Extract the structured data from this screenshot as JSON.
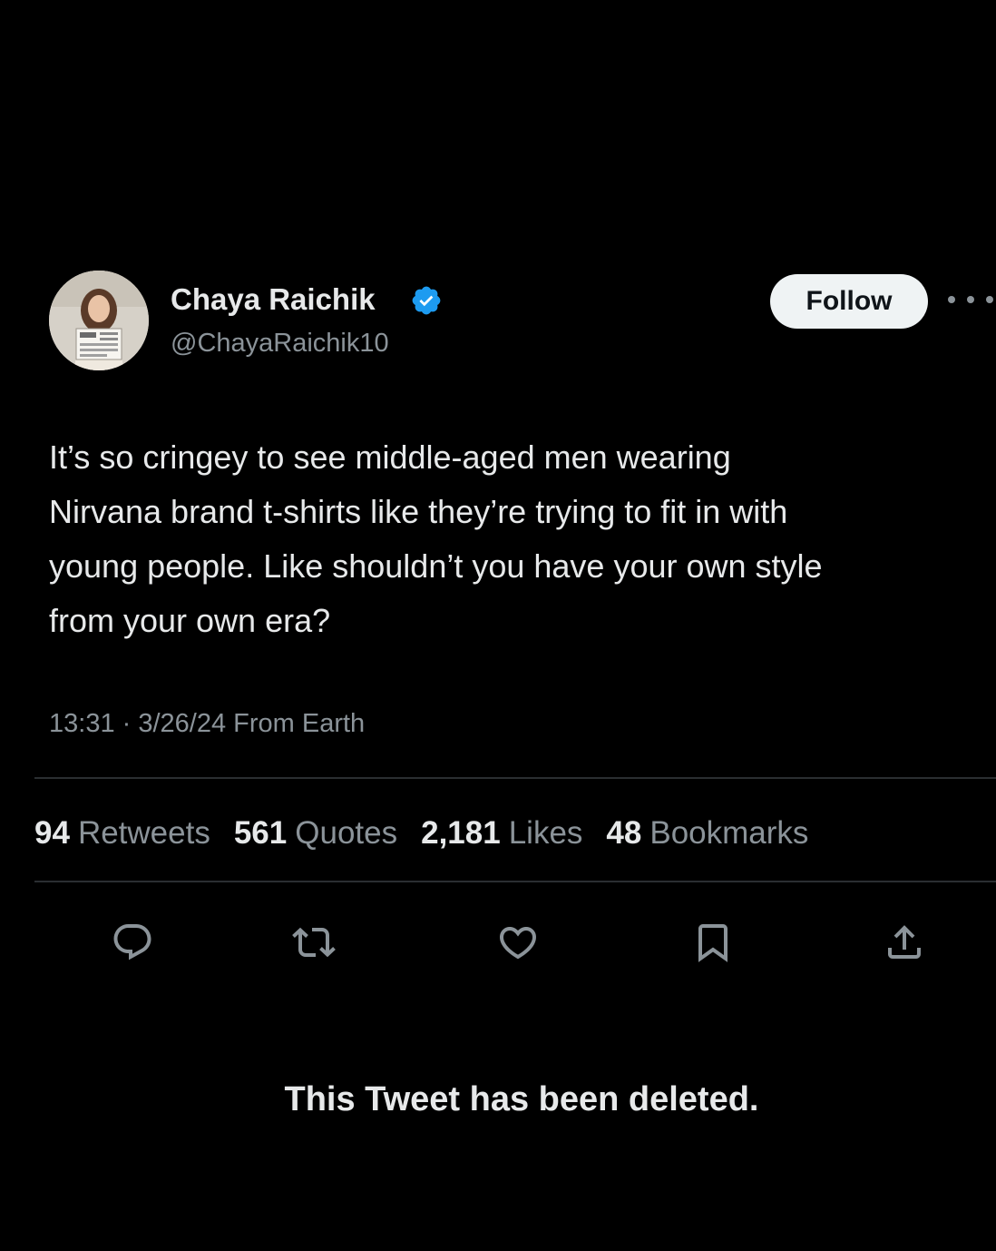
{
  "author": {
    "display_name": "Chaya Raichik",
    "handle": "@ChayaRaichik10",
    "verified": true,
    "avatar_icon": "profile-photo"
  },
  "follow_label": "Follow",
  "more_icon": "more-icon",
  "tweet": {
    "text": "It’s so cringey to see middle-aged men wearing\nNirvana brand t-shirts like they’re trying to fit in with\nyoung people. Like shouldn’t you have your own style\nfrom your own era?",
    "meta": "13:31 · 3/26/24 From Earth"
  },
  "stats": [
    {
      "count": "94",
      "label": "Retweets"
    },
    {
      "count": "561",
      "label": "Quotes"
    },
    {
      "count": "2,181",
      "label": "Likes"
    },
    {
      "count": "48",
      "label": "Bookmarks"
    }
  ],
  "actions": [
    "reply-icon",
    "retweet-icon",
    "like-icon",
    "bookmark-icon",
    "share-icon"
  ],
  "overlay_text": "This Tweet has been deleted.",
  "colors": {
    "background": "#000000",
    "primary_text": "#e7e9ea",
    "secondary_text": "#8b9399",
    "verified_blue": "#1d9bf0",
    "follow_button_bg": "#eff3f4"
  }
}
